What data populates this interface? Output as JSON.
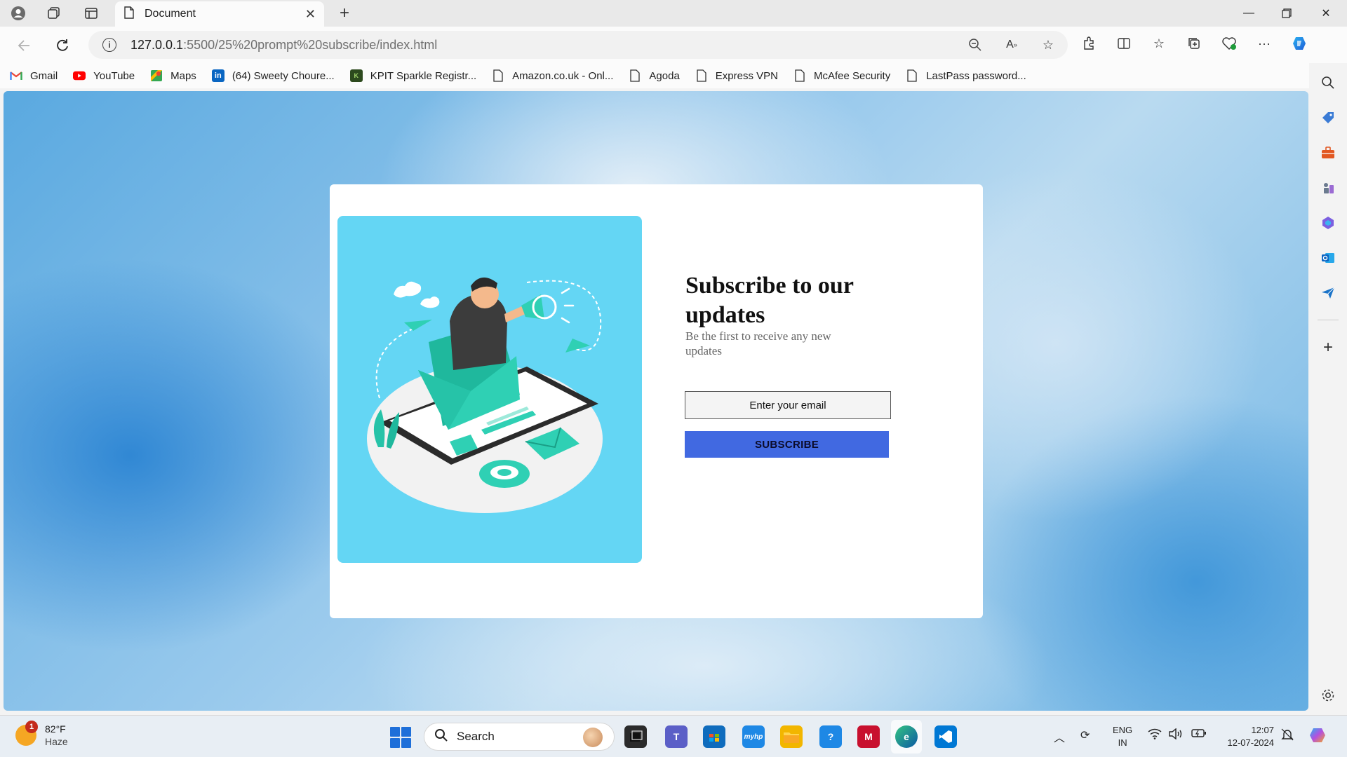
{
  "browser": {
    "tab_title": "Document",
    "url_host": "127.0.0.1",
    "url_path": ":5500/25%20prompt%20subscribe/index.html"
  },
  "bookmarks": [
    {
      "label": "Gmail",
      "icon": "gmail-icon",
      "color": "#ea4335"
    },
    {
      "label": "YouTube",
      "icon": "youtube-icon",
      "color": "#ff0000"
    },
    {
      "label": "Maps",
      "icon": "maps-icon",
      "color": "#34a853"
    },
    {
      "label": "(64) Sweety Choure...",
      "icon": "linkedin-icon",
      "color": "#0a66c2"
    },
    {
      "label": "KPIT Sparkle Registr...",
      "icon": "kpit-icon",
      "color": "#2d4a1e"
    },
    {
      "label": "Amazon.co.uk - Onl...",
      "icon": "page-icon",
      "color": "#333333"
    },
    {
      "label": "Agoda",
      "icon": "page-icon",
      "color": "#333333"
    },
    {
      "label": "Express VPN",
      "icon": "page-icon",
      "color": "#333333"
    },
    {
      "label": "McAfee Security",
      "icon": "page-icon",
      "color": "#333333"
    },
    {
      "label": "LastPass password...",
      "icon": "page-icon",
      "color": "#333333"
    }
  ],
  "page": {
    "heading": "Subscribe to our updates",
    "subtext": "Be the first to receive any new updates",
    "email_placeholder": "Enter your email",
    "button_label": "SUBSCRIBE",
    "accent_color": "#4169e1",
    "illustration_bg": "#64d6f4"
  },
  "taskbar": {
    "temperature": "82°F",
    "condition": "Haze",
    "weather_badge": "1",
    "search_label": "Search",
    "lang_line1": "ENG",
    "lang_line2": "IN",
    "time": "12:07",
    "date": "12-07-2024"
  }
}
